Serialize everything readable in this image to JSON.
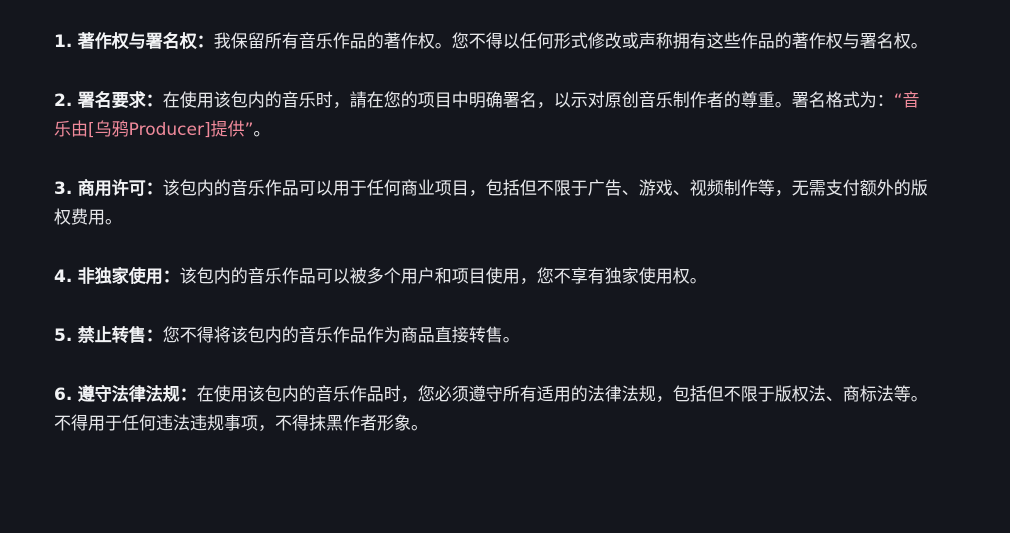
{
  "clauses": [
    {
      "number": "1.",
      "heading": "著作权与署名权：",
      "text": "我保留所有音乐作品的著作权。您不得以任何形式修改或声称拥有这些作品的著作权与署名权。"
    },
    {
      "number": "2.",
      "heading": "署名要求：",
      "text": "在使用该包内的音乐时，請在您的项目中明确署名，以示对原创音乐制作者的尊重。署名格式为：",
      "highlight": "“音乐由[乌鸦Producer]提供”",
      "text_after": "。"
    },
    {
      "number": "3.",
      "heading": "商用许可：",
      "text": "该包内的音乐作品可以用于任何商业项目，包括但不限于广告、游戏、视频制作等，无需支付额外的版权费用。"
    },
    {
      "number": "4.",
      "heading": "非独家使用：",
      "text": "该包内的音乐作品可以被多个用户和项目使用，您不享有独家使用权。"
    },
    {
      "number": "5.",
      "heading": "禁止转售：",
      "text": "您不得将该包内的音乐作品作为商品直接转售。"
    },
    {
      "number": "6.",
      "heading": "遵守法律法规：",
      "text": "在使用该包内的音乐作品时，您必须遵守所有适用的法律法规，包括但不限于版权法、商标法等。不得用于任何违法违规事项，不得抹黑作者形象。"
    }
  ],
  "colors": {
    "background": "#14161d",
    "text": "#e6e7ea",
    "highlight": "#f08a9b"
  }
}
